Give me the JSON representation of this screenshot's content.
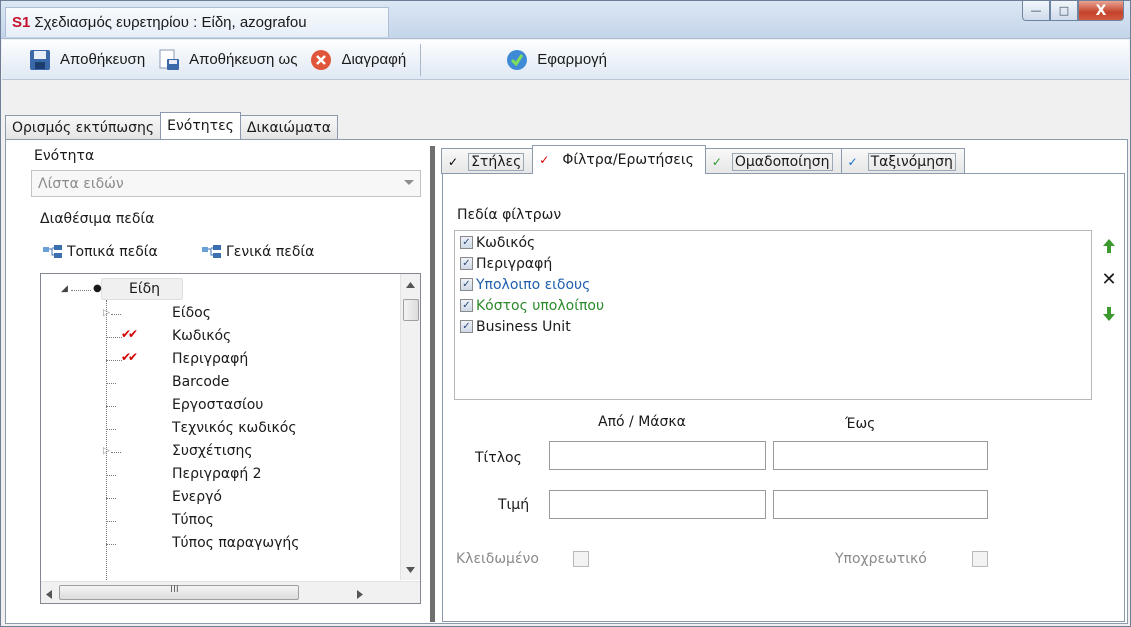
{
  "window": {
    "logo": "S1",
    "title": "Σχεδιασμός ευρετηρίου : Είδη, azografou",
    "controls": {
      "minimize": "—",
      "maximize": "□",
      "close": "X"
    }
  },
  "toolbar": {
    "save": "Αποθήκευση",
    "save_as": "Αποθήκευση ως",
    "delete": "Διαγραφή",
    "apply": "Εφαρμογή"
  },
  "main_tabs": [
    {
      "label": "Ορισμός εκτύπωσης",
      "active": false
    },
    {
      "label": "Ενότητες",
      "active": true
    },
    {
      "label": "Δικαιώματα",
      "active": false
    }
  ],
  "left": {
    "section_label": "Ενότητα",
    "section_value": "Λίστα ειδών",
    "available_fields_label": "Διαθέσιμα πεδία",
    "local_fields": "Τοπικά πεδία",
    "general_fields": "Γενικά πεδία",
    "tree": {
      "root": "Είδη",
      "items": [
        {
          "label": "Είδος",
          "expandable": true,
          "checked": false
        },
        {
          "label": "Κωδικός",
          "expandable": false,
          "checked": true
        },
        {
          "label": "Περιγραφή",
          "expandable": false,
          "checked": true
        },
        {
          "label": "Barcode",
          "expandable": false,
          "checked": false
        },
        {
          "label": "Εργοστασίου",
          "expandable": false,
          "checked": false
        },
        {
          "label": "Τεχνικός κωδικός",
          "expandable": false,
          "checked": false
        },
        {
          "label": "Συσχέτισης",
          "expandable": true,
          "checked": false
        },
        {
          "label": "Περιγραφή 2",
          "expandable": false,
          "checked": false
        },
        {
          "label": "Ενεργό",
          "expandable": false,
          "checked": false
        },
        {
          "label": "Τύπος",
          "expandable": false,
          "checked": false
        },
        {
          "label": "Τύπος παραγωγής",
          "expandable": false,
          "checked": false
        }
      ],
      "hscroll_grip": "III"
    }
  },
  "right": {
    "tabs": [
      {
        "label": "Στήλες",
        "check_color": "#000000",
        "active": false
      },
      {
        "label": "Φίλτρα/Ερωτήσεις",
        "check_color": "#d40000",
        "active": true
      },
      {
        "label": "Ομαδοποίηση",
        "check_color": "#2a9a2a",
        "active": false
      },
      {
        "label": "Ταξινόμηση",
        "check_color": "#1a6fd0",
        "active": false
      }
    ],
    "filter_fields_label": "Πεδία φίλτρων",
    "filter_fields": [
      {
        "label": "Κωδικός",
        "color": "#1a1a1a",
        "checked": true
      },
      {
        "label": "Περιγραφή",
        "color": "#1a1a1a",
        "checked": true
      },
      {
        "label": "Υπολοιπο ειδους",
        "color": "#1f5fae",
        "checked": true
      },
      {
        "label": "Κόστος υπολοίπου",
        "color": "#2a8a2a",
        "checked": true
      },
      {
        "label": "Business Unit",
        "color": "#1a1a1a",
        "checked": true
      }
    ],
    "from_mask_header": "Από / Μάσκα",
    "to_header": "Έως",
    "row_title": "Τίτλος",
    "row_value": "Τιμή",
    "title_from": "",
    "title_to": "",
    "value_from": "",
    "value_to": "",
    "locked_label": "Κλειδωμένο",
    "locked": false,
    "required_label": "Υποχρεωτικό",
    "required": false
  },
  "colors": {
    "title_bar": "#c4d5ea",
    "accent_red": "#d40000",
    "accent_green": "#2a8a2a",
    "accent_blue": "#1f5fae"
  }
}
